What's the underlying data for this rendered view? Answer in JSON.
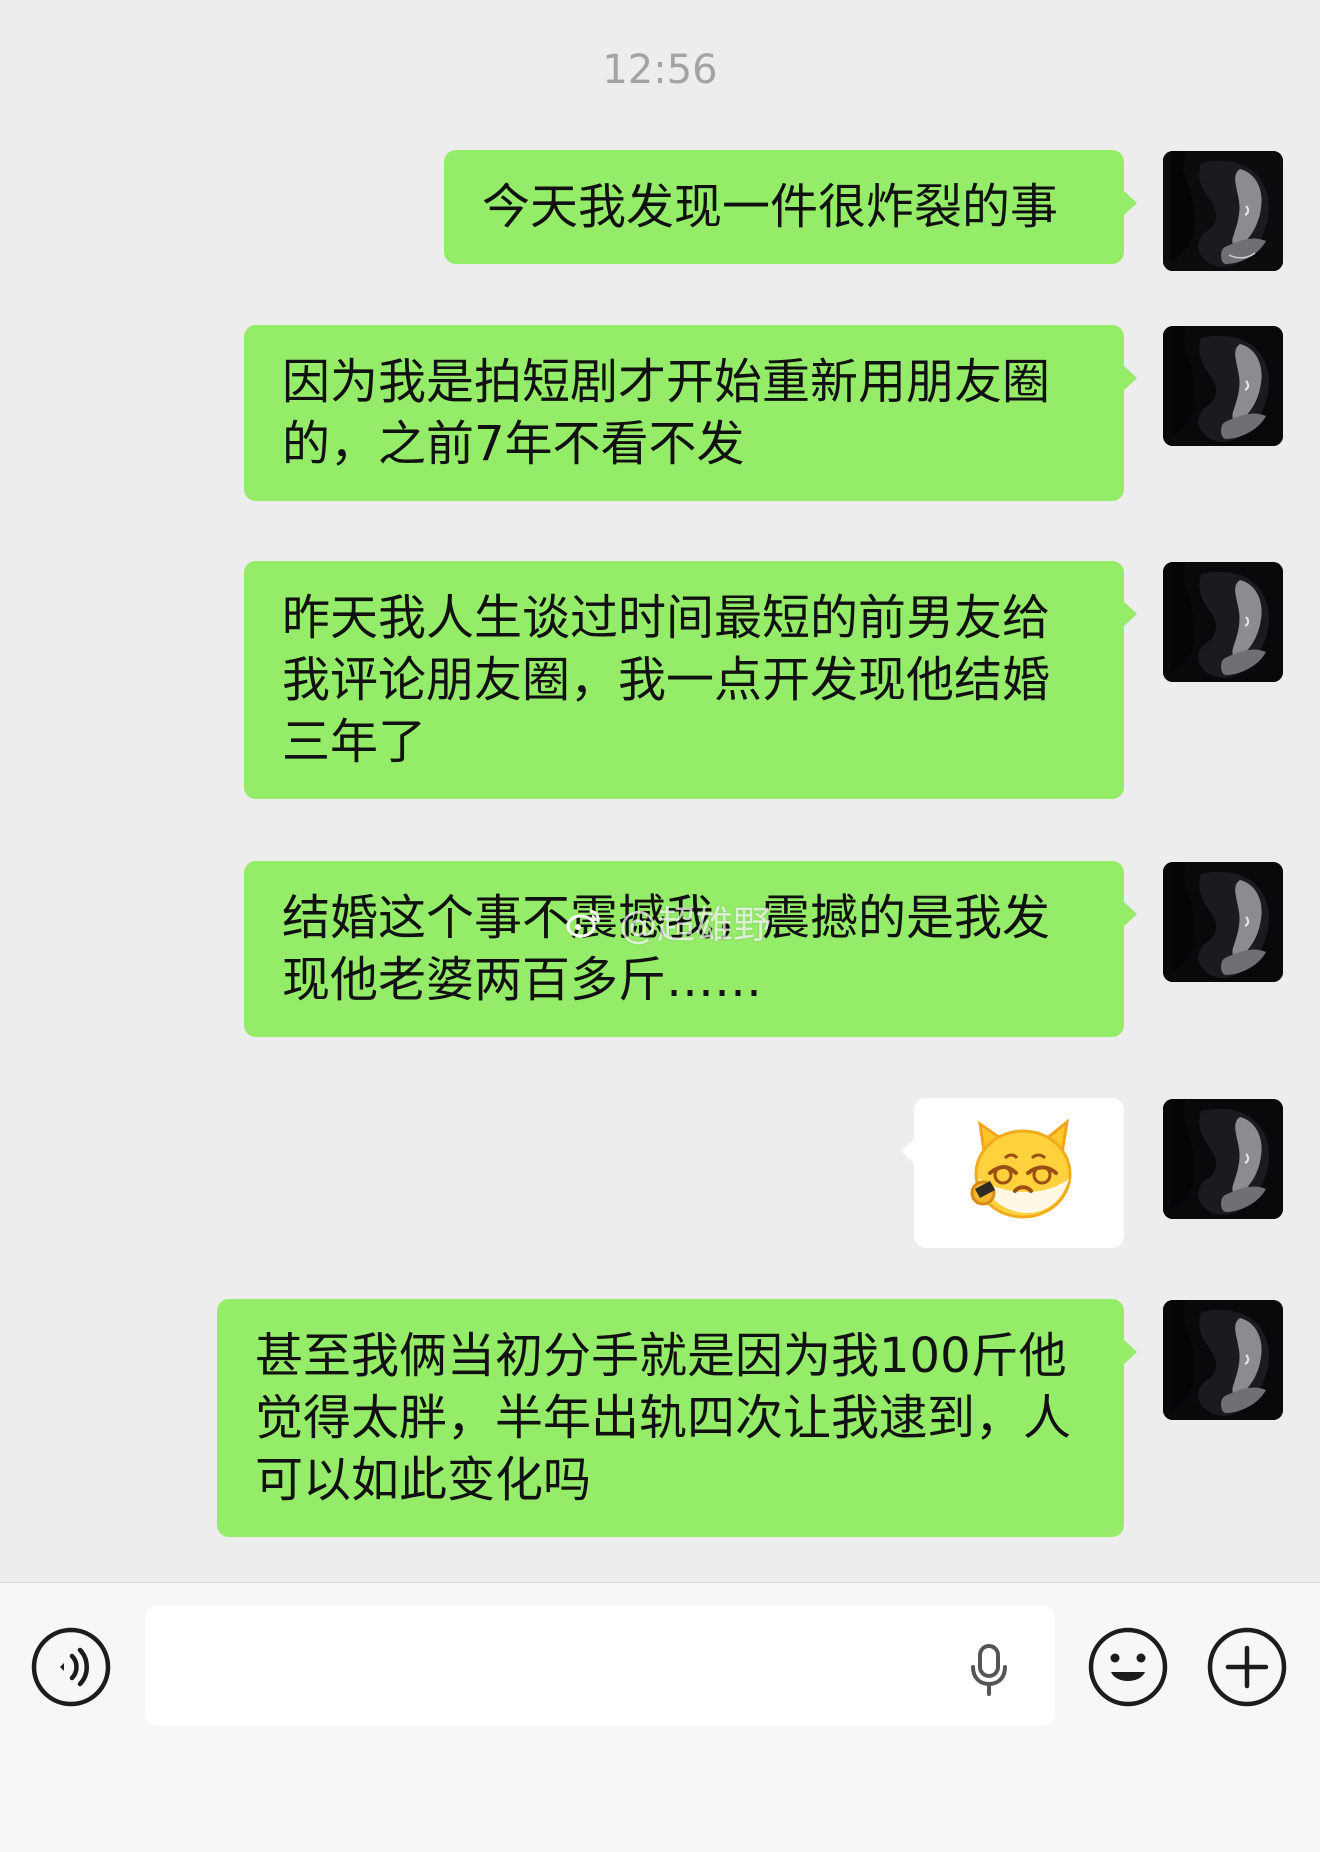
{
  "chat": {
    "timestamp": "12:56",
    "messages": [
      {
        "type": "text",
        "text": "今天我发现一件很炸裂的事"
      },
      {
        "type": "text",
        "text": "因为我是拍短剧才开始重新用朋友圈的，之前7年不看不发"
      },
      {
        "type": "text",
        "text": "昨天我人生谈过时间最短的前男友给我评论朋友圈，我一点开发现他结婚三年了"
      },
      {
        "type": "text",
        "text": "结婚这个事不震撼我，震撼的是我发现他老婆两百多斤……"
      },
      {
        "type": "sticker",
        "icon": "cat-sticker-icon"
      },
      {
        "type": "text",
        "text": "甚至我俩当初分手就是因为我100斤他觉得太胖，半年出轨四次让我逮到，人可以如此变化吗"
      }
    ],
    "watermark": "@超雄野"
  },
  "input_bar": {
    "voice_icon": "voice-icon",
    "mic_icon": "microphone-icon",
    "emoji_icon": "emoji-icon",
    "plus_icon": "plus-icon"
  },
  "colors": {
    "background": "#ededed",
    "bubble_green": "#95ec69",
    "sticker_bubble": "#ffffff",
    "input_bar": "#f7f7f7"
  }
}
